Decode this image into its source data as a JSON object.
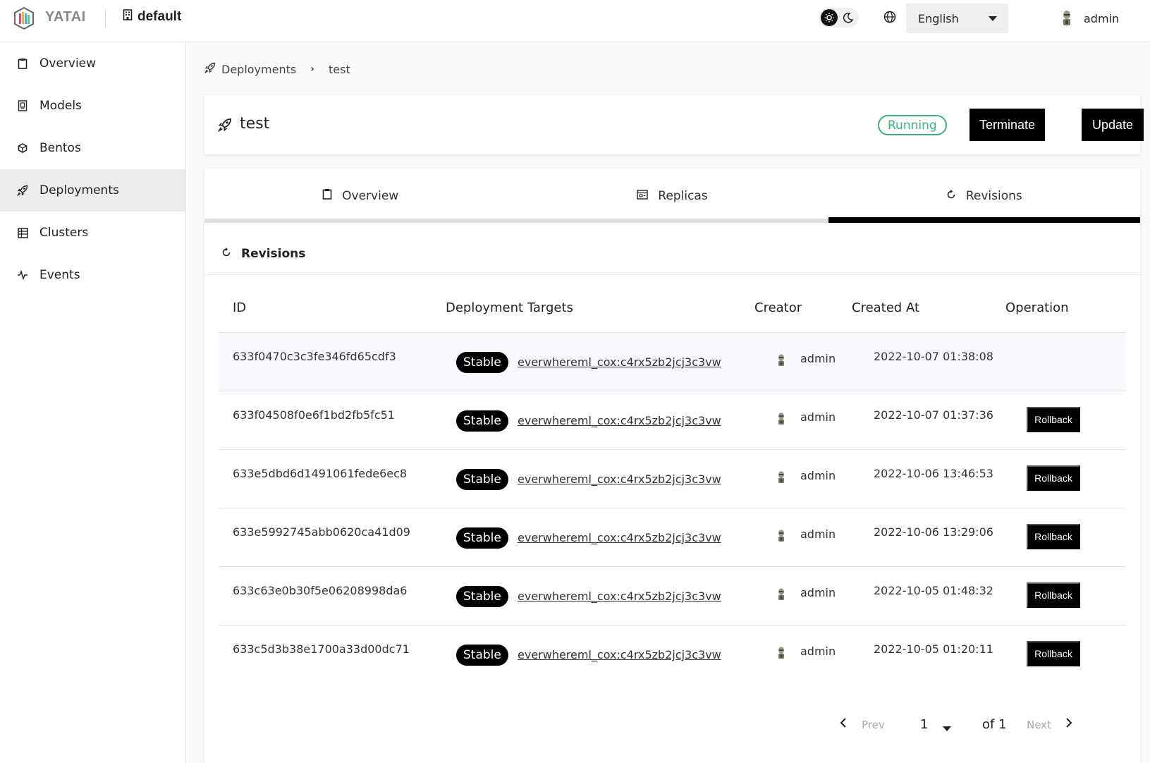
{
  "header": {
    "app_name": "YATAI",
    "org_name": "default",
    "language": "English",
    "username": "admin"
  },
  "sidebar": {
    "items": [
      {
        "label": "Overview",
        "icon": "clipboard-icon"
      },
      {
        "label": "Models",
        "icon": "model-icon"
      },
      {
        "label": "Bentos",
        "icon": "cube-icon"
      },
      {
        "label": "Deployments",
        "icon": "rocket-icon",
        "active": true
      },
      {
        "label": "Clusters",
        "icon": "table-icon"
      },
      {
        "label": "Events",
        "icon": "activity-icon"
      }
    ]
  },
  "breadcrumb": {
    "parent": "Deployments",
    "current": "test"
  },
  "deployment": {
    "name": "test",
    "status": "Running",
    "terminate_label": "Terminate",
    "update_label": "Update"
  },
  "tabs": [
    {
      "label": "Overview",
      "icon": "clipboard-icon"
    },
    {
      "label": "Replicas",
      "icon": "replicas-icon"
    },
    {
      "label": "Revisions",
      "icon": "revision-icon",
      "active": true
    }
  ],
  "revisions": {
    "section_title": "Revisions",
    "columns": [
      "ID",
      "Deployment Targets",
      "Creator",
      "Created At",
      "Operation"
    ],
    "rows": [
      {
        "id": "633f0470c3c3fe346fd65cdf3",
        "tag": "Stable",
        "target": "everwhereml_cox:c4rx5zb2jcj3c3vw",
        "creator": "admin",
        "created_at": "2022-10-07 01:38:08",
        "operation": ""
      },
      {
        "id": "633f04508f0e6f1bd2fb5fc51",
        "tag": "Stable",
        "target": "everwhereml_cox:c4rx5zb2jcj3c3vw",
        "creator": "admin",
        "created_at": "2022-10-07 01:37:36",
        "operation": "Rollback"
      },
      {
        "id": "633e5dbd6d1491061fede6ec8",
        "tag": "Stable",
        "target": "everwhereml_cox:c4rx5zb2jcj3c3vw",
        "creator": "admin",
        "created_at": "2022-10-06 13:46:53",
        "operation": "Rollback"
      },
      {
        "id": "633e5992745abb0620ca41d09",
        "tag": "Stable",
        "target": "everwhereml_cox:c4rx5zb2jcj3c3vw",
        "creator": "admin",
        "created_at": "2022-10-06 13:29:06",
        "operation": "Rollback"
      },
      {
        "id": "633c63e0b30f5e06208998da6",
        "tag": "Stable",
        "target": "everwhereml_cox:c4rx5zb2jcj3c3vw",
        "creator": "admin",
        "created_at": "2022-10-05 01:48:32",
        "operation": "Rollback"
      },
      {
        "id": "633c5d3b38e1700a33d00dc71",
        "tag": "Stable",
        "target": "everwhereml_cox:c4rx5zb2jcj3c3vw",
        "creator": "admin",
        "created_at": "2022-10-05 01:20:11",
        "operation": "Rollback"
      }
    ]
  },
  "pagination": {
    "prev_label": "Prev",
    "page": "1",
    "of_label": "of 1",
    "next_label": "Next"
  },
  "colors": {
    "status_green": "#3ab27a",
    "primary": "#000000"
  }
}
